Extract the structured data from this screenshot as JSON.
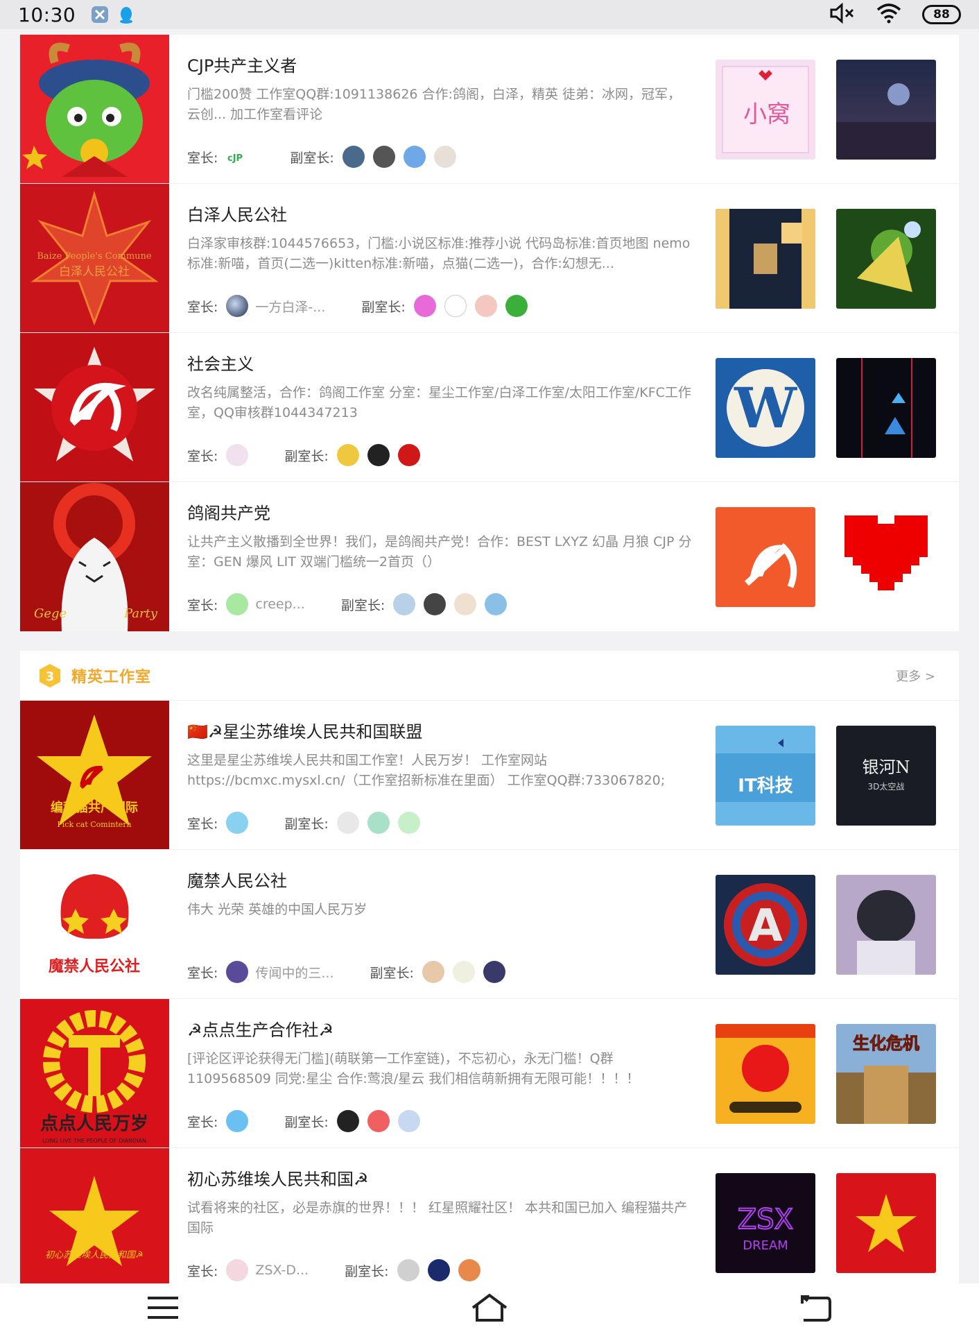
{
  "status_bar": {
    "time": "10:30",
    "battery": "88"
  },
  "studios_top": [
    {
      "title": "CJP共产主义者",
      "desc": "门槛200赞 工作室QQ群:1091138626 合作:鸽阁，白泽，精英 徒弟：冰网，冠军，云创... 加工作室看评论",
      "leader_label": "室长:",
      "leader_name": "",
      "vice_label": "副室长:"
    },
    {
      "title": "白泽人民公社",
      "desc": "白泽家审核群:1044576653，门槛:小说区标准:推荐小说 代码岛标准:首页地图 nemo标准:新喵，首页(二选一)kitten标准:新喵，点猫(二选一)，合作:幻想无...",
      "leader_label": "室长:",
      "leader_name": "一方白泽-...",
      "vice_label": "副室长:"
    },
    {
      "title": "社会主义",
      "desc": "改名纯属整活，合作：鸽阁工作室 分室：星尘工作室/白泽工作室/太阳工作室/KFC工作室，QQ审核群1044347213",
      "leader_label": "室长:",
      "leader_name": "",
      "vice_label": "副室长:"
    },
    {
      "title": "鸽阁共产党",
      "desc": "让共产主义散播到全世界！我们，是鸽阁共产党！合作：BEST LXYZ 幻晶 月狼 CJP 分室：GEN 爆风 LIT 双端门槛统一2首页（）",
      "leader_label": "室长:",
      "leader_name": "creep...",
      "vice_label": "副室长:"
    }
  ],
  "section": {
    "title": "精英工作室",
    "more": "更多 >"
  },
  "studios_elite": [
    {
      "title": "🇨🇳☭星尘苏维埃人民共和国联盟",
      "desc": "这里是星尘苏维埃人民共和国工作室！人民万岁！ 工作室网站https://bcmxc.mysxl.cn/（工作室招新标准在里面） 工作室QQ群:733067820;",
      "leader_label": "室长:",
      "leader_name": "",
      "vice_label": "副室长:"
    },
    {
      "title": "魔禁人民公社",
      "desc": "伟大 光荣 英雄的中国人民万岁",
      "leader_label": "室长:",
      "leader_name": "传闻中的三...",
      "vice_label": "副室长:"
    },
    {
      "title": "☭点点生产合作社☭",
      "desc": "[评论区评论获得无门槛](萌联第一工作室链)，不忘初心，永无门槛！Q群1109568509 同党:星尘 合作:莺浪/星云 我们相信萌新拥有无限可能！！！！",
      "leader_label": "室长:",
      "leader_name": "",
      "vice_label": "副室长:"
    },
    {
      "title": "初心苏维埃人民共和国☭",
      "desc": "试看将来的社区，必是赤旗的世界！！！ 红星照耀社区！ 本共和国已加入 编程猫共产国际",
      "leader_label": "室长:",
      "leader_name": "ZSX-D...",
      "vice_label": "副室长:"
    }
  ],
  "cover_text": {
    "baize_en": "Baize People's Commune",
    "baize_cn": "白泽人民公社",
    "gege_left": "Gege",
    "gege_right": "Party",
    "pickcat_cn": "编程猫共产国际",
    "pickcat_en": "Pick cat Comintern",
    "mojin": "魔禁人民公社",
    "diandian_cn": "点点人民万岁",
    "diandian_en": "LONG LIVE THE PEOPLE OF DIANDIAN",
    "chuxin": "初心苏维埃人民共和国☭"
  },
  "thumb_text": {
    "xiaowo": "小窝",
    "it_title": "IT科技",
    "yinhe": "银河N",
    "yinhe_sub": "3D太空战",
    "shenghua": "生化危机",
    "zsx": "ZSX",
    "dream": "DREAM"
  },
  "colors": {
    "accent": "#f0a92a",
    "red": "#d4141a",
    "text": "#222222",
    "muted": "#8c8c8c"
  }
}
